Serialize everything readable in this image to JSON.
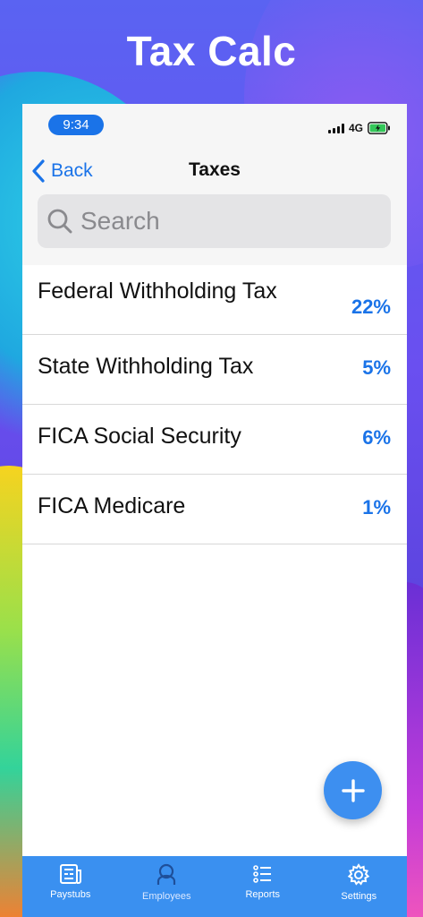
{
  "app_title": "Tax Calc",
  "status": {
    "time": "9:34",
    "network": "4G"
  },
  "nav": {
    "back_label": "Back",
    "title": "Taxes"
  },
  "search": {
    "placeholder": "Search"
  },
  "taxes": [
    {
      "name": "Federal Withholding Tax",
      "rate": "22%"
    },
    {
      "name": "State Withholding Tax",
      "rate": "5%"
    },
    {
      "name": "FICA Social Security",
      "rate": "6%"
    },
    {
      "name": "FICA Medicare",
      "rate": "1%"
    }
  ],
  "fab": {
    "icon": "plus-icon"
  },
  "tabs": [
    {
      "label": "Paystubs",
      "icon": "paystub-icon"
    },
    {
      "label": "Employees",
      "icon": "person-icon"
    },
    {
      "label": "Reports",
      "icon": "list-icon"
    },
    {
      "label": "Settings",
      "icon": "gear-icon"
    }
  ],
  "colors": {
    "accent": "#1a73e8",
    "tabbar": "#3a90f0",
    "fab": "#3d8ff0",
    "battery": "#34c759"
  }
}
